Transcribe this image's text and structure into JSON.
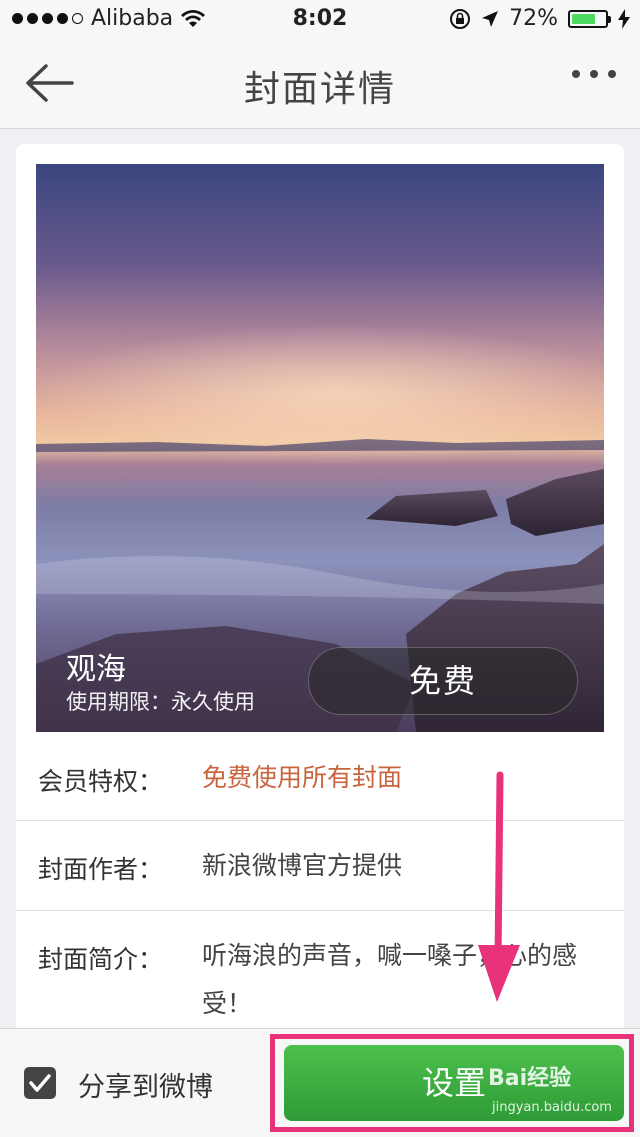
{
  "status_bar": {
    "carrier": "Alibaba",
    "time": "8:02",
    "battery_percent_text": "72%",
    "battery_level": 0.72,
    "icons": [
      "signal-dots-icon",
      "wifi-icon",
      "rotation-lock-icon",
      "location-arrow-icon",
      "battery-icon",
      "charging-icon"
    ]
  },
  "nav": {
    "title": "封面详情",
    "back_icon": "back-arrow-icon",
    "more_icon": "more-dots-icon"
  },
  "cover": {
    "name": "观海",
    "validity": "使用期限：永久使用",
    "price_button": "免费"
  },
  "details": [
    {
      "label": "会员特权：",
      "value": "免费使用所有封面",
      "accent": true
    },
    {
      "label": "封面作者：",
      "value": "新浪微博官方提供"
    },
    {
      "label": "封面简介：",
      "value": "听海浪的声音，喊一嗓子，心的感受！"
    }
  ],
  "bottom": {
    "share_label": "分享到微博",
    "share_checked": true,
    "set_button": "设置"
  },
  "watermark": {
    "text": "Bai经验",
    "sub": "jingyan.baidu.com"
  },
  "colors": {
    "accent_orange": "#c8653f",
    "green_button": "#3aab3f",
    "highlight_pink": "#e8337b"
  }
}
